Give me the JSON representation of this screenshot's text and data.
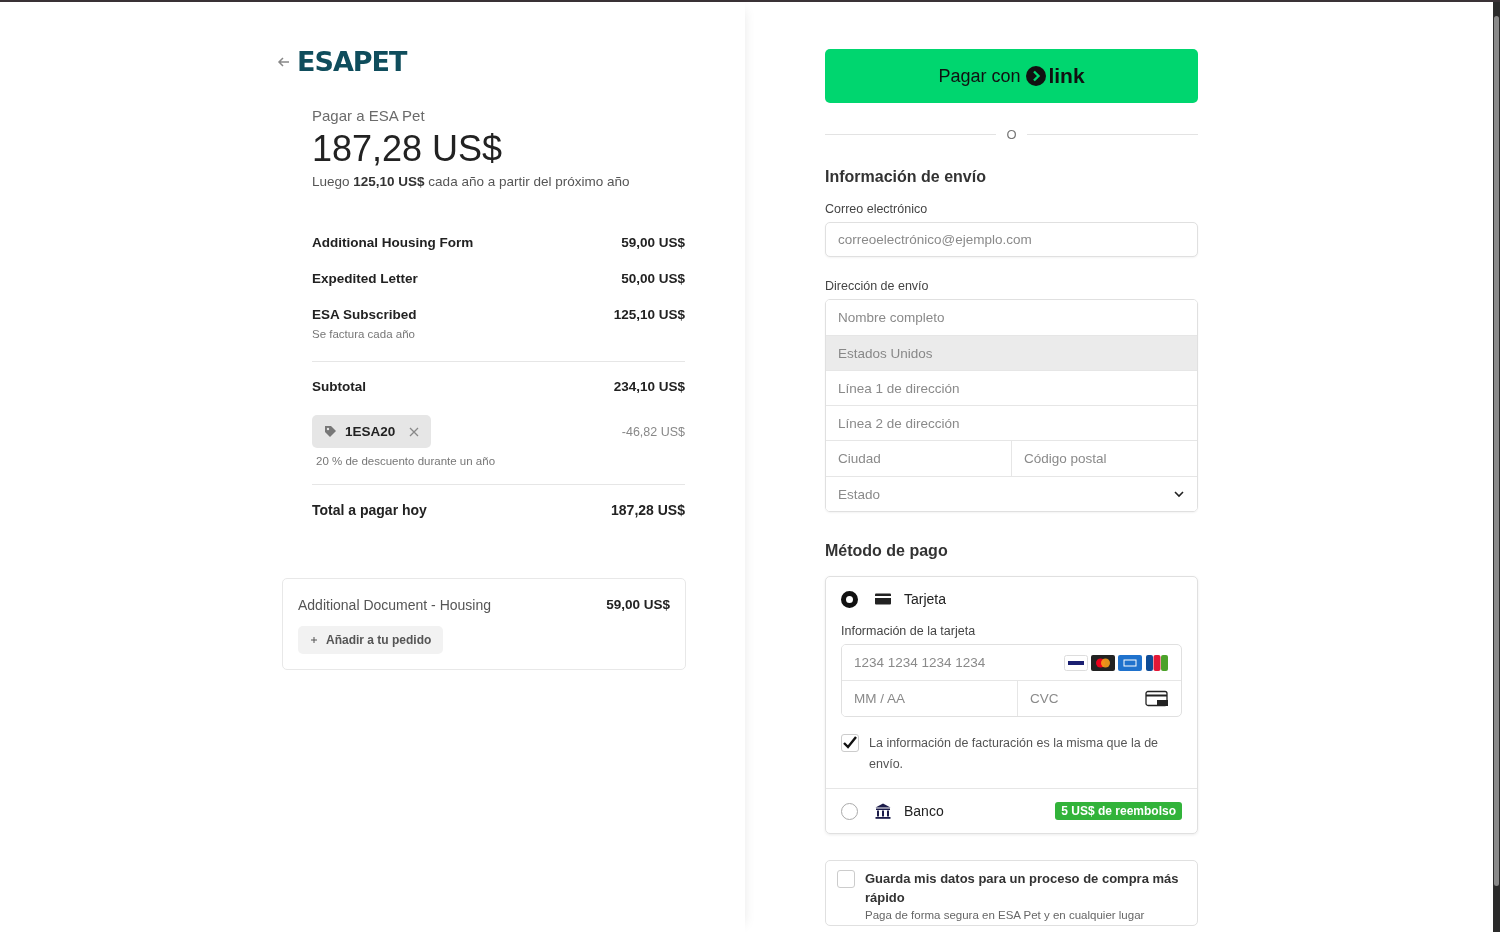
{
  "header": {
    "logo": "ESAPET"
  },
  "summary": {
    "pay_to": "Pagar a ESA Pet",
    "amount": "187,28 US$",
    "recurring": "Luego **125,10 US$** cada año a partir del próximo año"
  },
  "line_items": [
    {
      "name": "Additional Housing Form",
      "price": "59,00 US$"
    },
    {
      "name": "Expedited Letter",
      "price": "50,00 US$"
    },
    {
      "name": "ESA Subscribed",
      "price": "125,10 US$",
      "note": "Se factura cada año"
    }
  ],
  "subtotal": {
    "label": "Subtotal",
    "value": "234,10 US$"
  },
  "coupon": {
    "code": "1ESA20",
    "discount": "-46,82 US$",
    "description": "20 % de descuento durante un año"
  },
  "total": {
    "label": "Total a pagar hoy",
    "value": "187,28 US$"
  },
  "upsell": {
    "name": "Additional Document - Housing",
    "price": "59,00 US$",
    "button": "Añadir a tu pedido"
  },
  "link_button": {
    "label": "Pagar con",
    "brand": "link"
  },
  "divider": "O",
  "shipping": {
    "title": "Información de envío",
    "email_label": "Correo electrónico",
    "email_placeholder": "correoelectrónico@ejemplo.com",
    "address_label": "Dirección de envío",
    "fields": [
      {
        "kind": "text",
        "placeholder": "Nombre completo"
      },
      {
        "kind": "country",
        "value": "Estados Unidos"
      },
      {
        "kind": "text",
        "placeholder": "Línea 1 de dirección"
      },
      {
        "kind": "text",
        "placeholder": "Línea 2 de dirección"
      },
      {
        "kind": "pair",
        "placeholders": [
          "Ciudad",
          "Código postal"
        ]
      },
      {
        "kind": "select",
        "placeholder": "Estado"
      }
    ]
  },
  "payment": {
    "title": "Método de pago",
    "methods": [
      {
        "kind": "card",
        "label": "Tarjeta",
        "selected": true,
        "card_label": "Información de la tarjeta",
        "number_placeholder": "1234 1234 1234 1234",
        "expiry_placeholder": "MM / AA",
        "cvc_placeholder": "CVC",
        "same_billing": {
          "text": "La información de facturación es la misma que la de envío.",
          "checked": true
        }
      },
      {
        "kind": "bank",
        "label": "Banco",
        "selected": false,
        "badge": "5 US$ de reembolso"
      }
    ]
  },
  "save": {
    "title": "Guarda mis datos para un proceso de compra más rápido",
    "subtitle": "Paga de forma segura en ESA Pet y en cualquier lugar",
    "checked": false
  }
}
